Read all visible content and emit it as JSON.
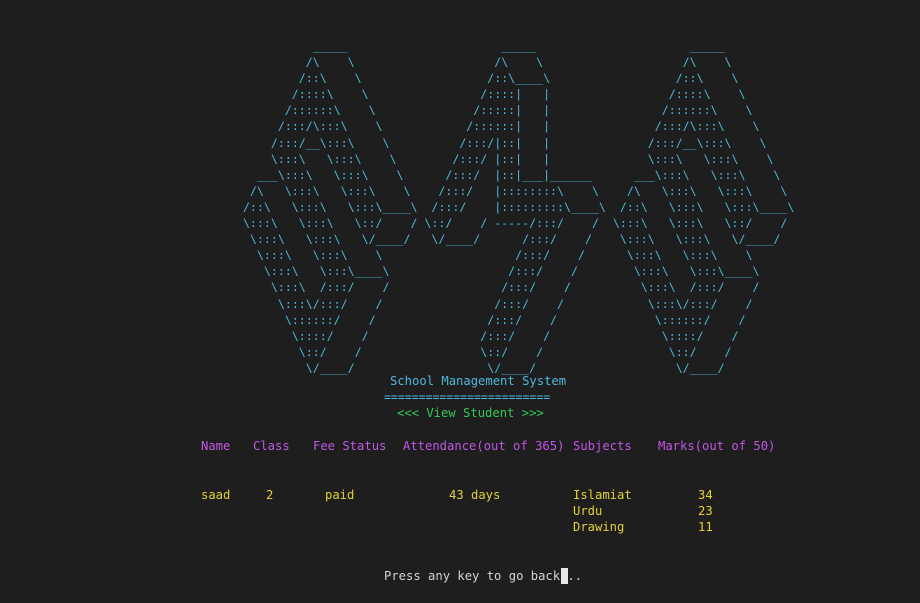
{
  "banner_art": "             _____                      _____                      _____\n            /\\    \\                    /\\    \\                    /\\    \\\n           /::\\    \\                  /::\\____\\                  /::\\    \\\n          /::::\\    \\                /::::|   |                 /::::\\    \\\n         /::::::\\    \\              /:::::|   |                /::::::\\    \\\n        /:::/\\:::\\    \\            /::::::|   |               /:::/\\:::\\    \\\n       /:::/__\\:::\\    \\          /:::/|::|   |              /:::/__\\:::\\    \\\n       \\:::\\   \\:::\\    \\        /:::/ |::|   |              \\:::\\   \\:::\\    \\\n     ___\\:::\\   \\:::\\    \\      /:::/  |::|___|______      ___\\:::\\   \\:::\\    \\\n    /\\   \\:::\\   \\:::\\    \\    /:::/   |::::::::\\    \\    /\\   \\:::\\   \\:::\\    \\\n   /::\\   \\:::\\   \\:::\\____\\  /:::/    |:::::::::\\____\\  /::\\   \\:::\\   \\:::\\____\\\n   \\:::\\   \\:::\\   \\::/    / \\::/    / -----/:::/    /  \\:::\\   \\:::\\   \\::/    /\n    \\:::\\   \\:::\\   \\/____/   \\/____/      /:::/    /    \\:::\\   \\:::\\   \\/____/\n     \\:::\\   \\:::\\    \\                   /:::/    /      \\:::\\   \\:::\\    \\\n      \\:::\\   \\:::\\____\\                 /:::/    /        \\:::\\   \\:::\\____\\\n       \\:::\\  /:::/    /                /:::/    /          \\:::\\  /:::/    /\n        \\:::\\/:::/    /                /:::/    /            \\:::\\/:::/    /\n         \\::::::/    /                /:::/    /              \\::::::/    /\n          \\::::/    /                /:::/    /                \\::::/    /\n           \\::/    /                 \\::/    /                  \\::/    /\n            \\/____/                   \\/____/                    \\/____/",
  "app_title": "School Management System",
  "separator": "========================",
  "view_label": "<<< View Student >>>",
  "table": {
    "headers": {
      "name": "Name",
      "class": "Class",
      "fee_status": "Fee Status",
      "attendance": "Attendance(out of 365)",
      "subjects": "Subjects",
      "marks": "Marks(out of 50)"
    },
    "student": {
      "name": "saad",
      "class": "2",
      "fee_status": "paid",
      "attendance": "43 days",
      "results": [
        {
          "subject": "Islamiat",
          "marks": "34"
        },
        {
          "subject": "Urdu",
          "marks": "23"
        },
        {
          "subject": "Drawing",
          "marks": "11"
        }
      ]
    }
  },
  "prompt": "Press any key to go back...",
  "colors": {
    "background": "#1e1e1e",
    "banner": "#4fb7dd",
    "view_label": "#35c95a",
    "headers": "#c256e6",
    "values": "#e2d138",
    "prompt": "#d4d4d4"
  }
}
